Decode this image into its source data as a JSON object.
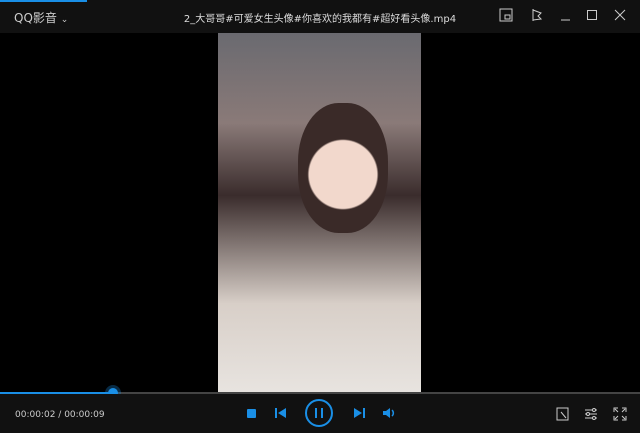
{
  "app": {
    "name": "QQ影音",
    "menu_arrow": "⌄"
  },
  "window": {
    "title": "2_大哥哥#可爱女生头像#你喜欢的我都有#超好看头像.mp4"
  },
  "player": {
    "current_time": "00:00:02",
    "total_time": "00:00:09",
    "time_separator": " / ",
    "progress_percent": 17.7,
    "accent_color": "#1a8fe6"
  },
  "icons": [
    "mini-mode-icon",
    "pin-icon",
    "minimize-icon",
    "maximize-icon",
    "close-icon",
    "stop-icon",
    "previous-icon",
    "pause-icon",
    "next-icon",
    "volume-icon",
    "screenshot-icon",
    "settings-icon",
    "fullscreen-icon"
  ]
}
